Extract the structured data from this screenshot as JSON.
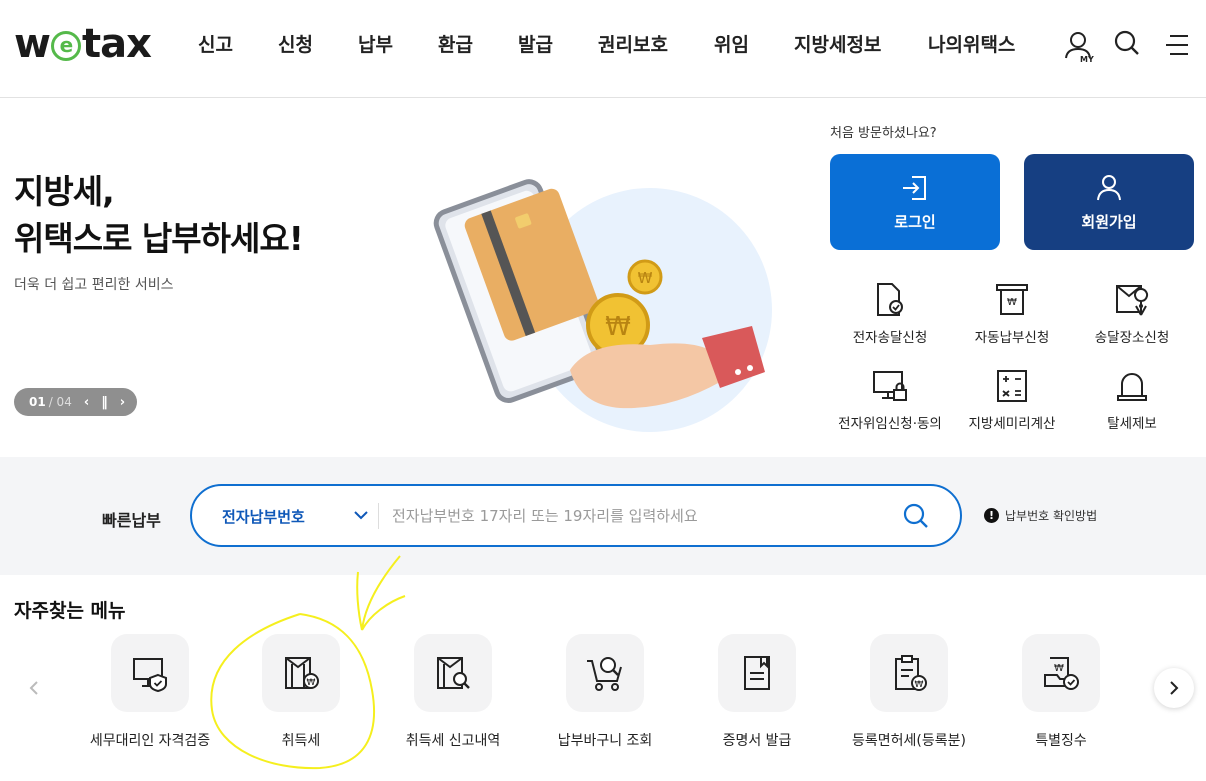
{
  "header": {
    "logo_left": "w",
    "logo_e": "e",
    "logo_right": "tax",
    "nav": [
      "신고",
      "신청",
      "납부",
      "환급",
      "발급",
      "권리보호",
      "위임",
      "지방세정보",
      "나의위택스"
    ],
    "my_label": "MY",
    "icons": [
      "user-my-icon",
      "search-icon",
      "menu-icon"
    ]
  },
  "hero": {
    "title_line1": "지방세,",
    "title_line2": "위택스로 납부하세요!",
    "subtitle": "더욱 더 쉽고 편리한 서비스",
    "slide_current": "01",
    "slide_total": "/ 04"
  },
  "visit": {
    "question": "처음 방문하셨나요?",
    "login_label": "로그인",
    "join_label": "회원가입"
  },
  "services": [
    {
      "label": "전자송달신청",
      "icon": "document-check-icon"
    },
    {
      "label": "자동납부신청",
      "icon": "auto-pay-icon"
    },
    {
      "label": "송달장소신청",
      "icon": "envelope-location-icon"
    },
    {
      "label": "전자위임신청·동의",
      "icon": "monitor-lock-icon"
    },
    {
      "label": "지방세미리계산",
      "icon": "calculator-icon"
    },
    {
      "label": "탈세제보",
      "icon": "siren-icon"
    }
  ],
  "quick_pay": {
    "label": "빠른납부",
    "select_value": "전자납부번호",
    "placeholder": "전자납부번호 17자리 또는 19자리를 입력하세요",
    "help_label": "납부번호 확인방법"
  },
  "frequent": {
    "title": "자주찾는 메뉴",
    "items": [
      {
        "label": "세무대리인 자격검증",
        "icon": "monitor-shield-icon"
      },
      {
        "label": "취득세",
        "icon": "acquisition-tax-icon"
      },
      {
        "label": "취득세 신고내역",
        "icon": "tax-search-icon"
      },
      {
        "label": "납부바구니 조회",
        "icon": "cart-search-icon"
      },
      {
        "label": "증명서 발급",
        "icon": "certificate-icon"
      },
      {
        "label": "등록면허세(등록분)",
        "icon": "clipboard-tax-icon"
      },
      {
        "label": "특별징수",
        "icon": "special-collection-icon"
      }
    ]
  },
  "colors": {
    "brand_green": "#55b94a",
    "login_blue": "#0a6fd6",
    "join_navy": "#163f82",
    "accent_blue": "#0f6fd0",
    "annotation_yellow": "#f5ef1e"
  }
}
